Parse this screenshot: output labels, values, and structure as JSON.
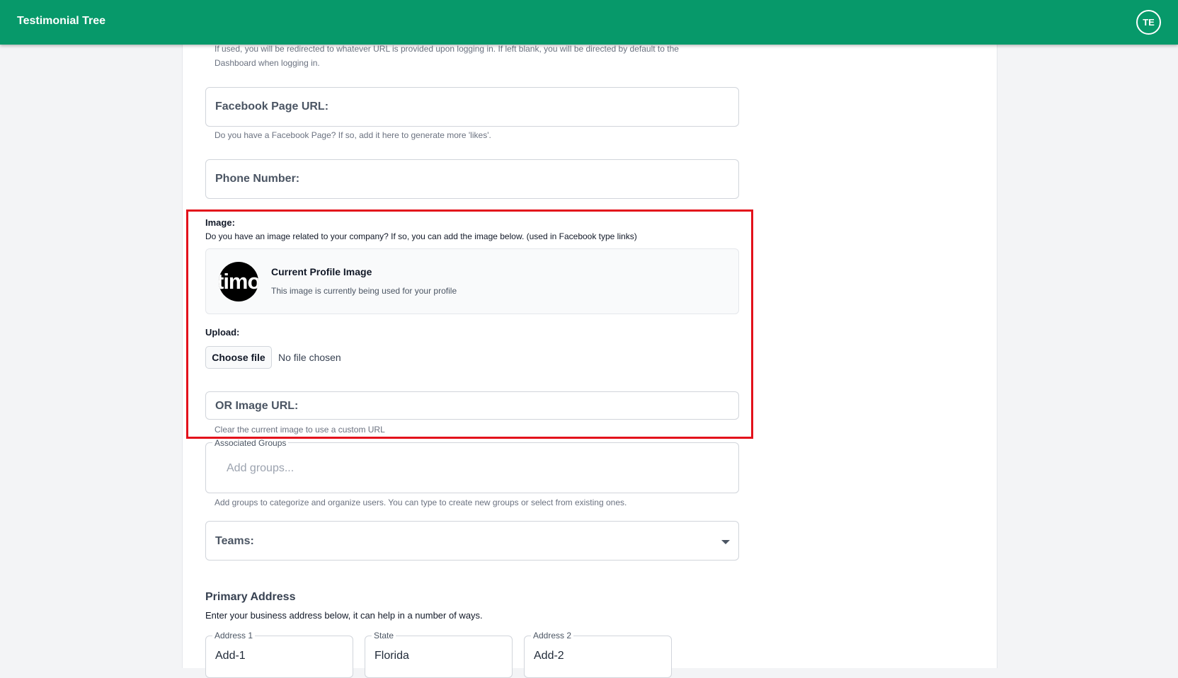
{
  "app": {
    "title": "Testimonial Tree",
    "user_initials": "TE"
  },
  "form": {
    "redirect_hint_line1": "If used, you will be redirected to whatever URL is provided upon logging in. If left blank, you will be directed by default to the",
    "redirect_hint_line2": "Dashboard when logging in.",
    "facebook": {
      "label": "Facebook Page URL:",
      "hint": "Do you have a Facebook Page? If so, add it here to generate more 'likes'."
    },
    "phone": {
      "label": "Phone Number:"
    },
    "image": {
      "label": "Image:",
      "description": "Do you have an image related to your company? If so, you can add the image below. (used in Facebook type links)",
      "current_title": "Current Profile Image",
      "current_subtitle": "This image is currently being used for your profile",
      "avatar_text": "timo",
      "upload_label": "Upload:",
      "choose_button": "Choose file",
      "file_status": "No file chosen",
      "url_label": "OR Image URL:",
      "url_hint": "Clear the current image to use a custom URL"
    },
    "groups": {
      "label": "Associated Groups",
      "placeholder": "Add groups...",
      "hint": "Add groups to categorize and organize users. You can type to create new groups or select from existing ones."
    },
    "teams": {
      "label": "Teams:"
    },
    "address": {
      "title": "Primary Address",
      "description": "Enter your business address below, it can help in a number of ways.",
      "fields": [
        {
          "label": "Address 1",
          "value": "Add-1"
        },
        {
          "label": "State",
          "value": "Florida"
        },
        {
          "label": "Address 2",
          "value": "Add-2"
        }
      ]
    }
  },
  "colors": {
    "brand": "#07996a",
    "highlight": "#e3111b"
  }
}
